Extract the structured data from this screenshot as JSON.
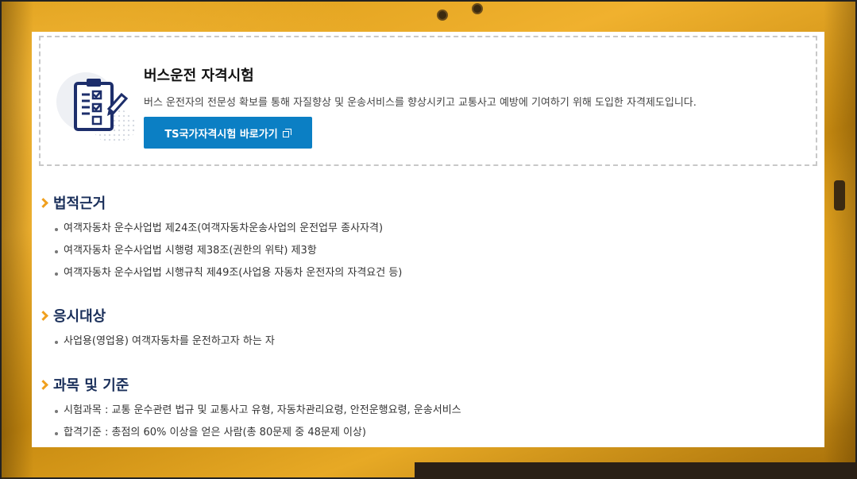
{
  "intro": {
    "title": "버스운전 자격시험",
    "description": "버스 운전자의 전문성 확보를 통해 자질향상 및 운송서비스를 향상시키고 교통사고 예방에 기여하기 위해 도입한 자격제도입니다.",
    "button_label": "TS국가자격시험 바로가기",
    "icon": "clipboard-checklist-icon"
  },
  "sections": [
    {
      "title": "법적근거",
      "items": [
        "여객자동차 운수사업법 제24조(여객자동차운송사업의 운전업무 종사자격)",
        "여객자동차 운수사업법 시행령 제38조(권한의 위탁) 제3항",
        "여객자동차 운수사업법 시행규칙 제49조(사업용 자동차 운전자의 자격요건 등)"
      ]
    },
    {
      "title": "응시대상",
      "items": [
        "사업용(영업용) 여객자동차를 운전하고자 하는 자"
      ]
    },
    {
      "title": "과목 및 기준",
      "items": [
        "시험과목 : 교통 운수관련 법규 및 교통사고 유형, 자동차관리요령, 안전운행요령, 운송서비스",
        "합격기준 : 총점의 60% 이상을 얻은 사람(총 80문제 중 48문제 이상)"
      ]
    }
  ],
  "colors": {
    "accent": "#0b7fc4",
    "heading": "#1a2f5a",
    "chevron": "#f0a01e",
    "background": "#e7a925"
  }
}
